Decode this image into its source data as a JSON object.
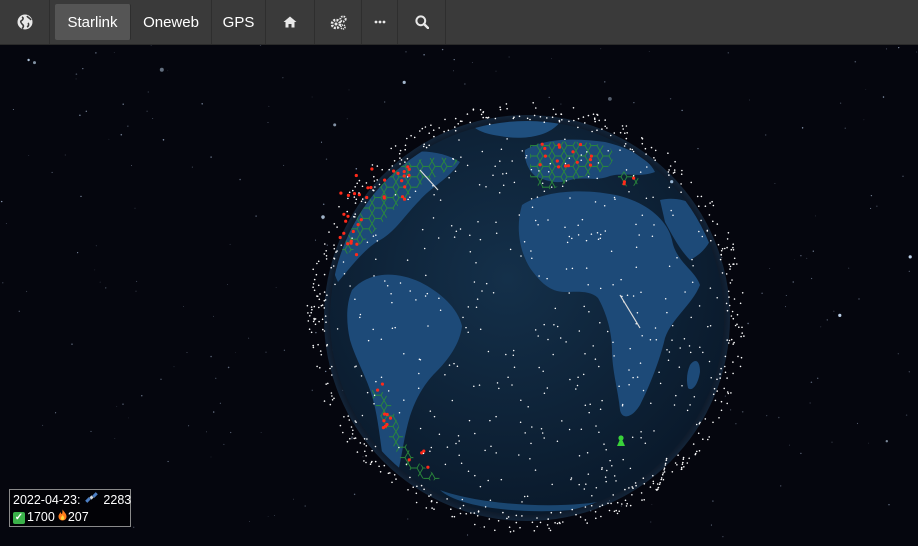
{
  "nav": {
    "items": [
      {
        "id": "globe",
        "icon": "globe-icon"
      },
      {
        "id": "starlink",
        "label": "Starlink",
        "active": true
      },
      {
        "id": "oneweb",
        "label": "Oneweb"
      },
      {
        "id": "gps",
        "label": "GPS"
      },
      {
        "id": "home",
        "icon": "home-icon"
      },
      {
        "id": "settings",
        "icon": "gears-icon"
      },
      {
        "id": "more",
        "icon": "ellipsis-icon"
      },
      {
        "id": "search",
        "icon": "search-icon"
      }
    ]
  },
  "stats": {
    "date_label": "2022-04-23:",
    "satellite_count": "2283",
    "active_count": "1700",
    "burned_count": "207"
  },
  "colors": {
    "topbar": "#3a3a3a",
    "active_tab": "#555555",
    "space": "#05060e",
    "ocean": "#0f2236",
    "land": "#1d4a78",
    "satellite": "#ffffff",
    "coverage_hex": "#2a8a3a",
    "ground_station": "#ff2a1a",
    "user_marker": "#39d13a"
  }
}
